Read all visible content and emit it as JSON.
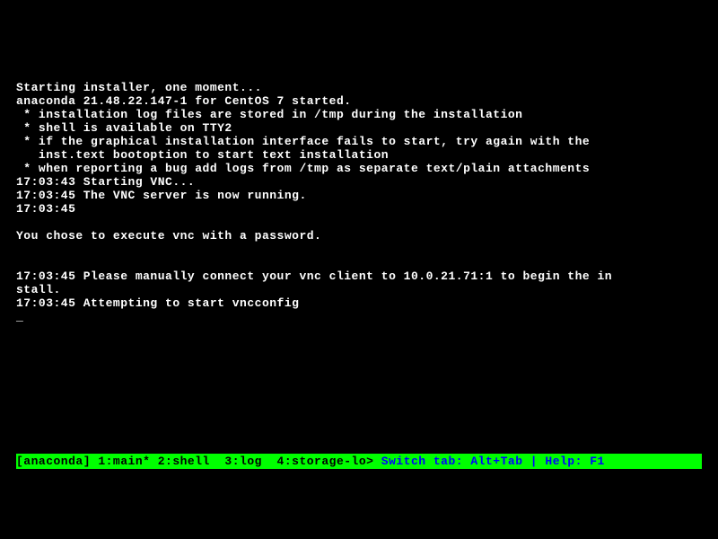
{
  "terminal": {
    "lines": [
      "Starting installer, one moment...",
      "anaconda 21.48.22.147-1 for CentOS 7 started.",
      " * installation log files are stored in /tmp during the installation",
      " * shell is available on TTY2",
      " * if the graphical installation interface fails to start, try again with the",
      "   inst.text bootoption to start text installation",
      " * when reporting a bug add logs from /tmp as separate text/plain attachments",
      "17:03:43 Starting VNC...",
      "17:03:45 The VNC server is now running.",
      "17:03:45 ",
      "",
      "You chose to execute vnc with a password. ",
      "",
      "",
      "17:03:45 Please manually connect your vnc client to 10.0.21.71:1 to begin the in",
      "stall.",
      "17:03:45 Attempting to start vncconfig"
    ],
    "cursor": "_"
  },
  "statusbar": {
    "left": "[anaconda] 1:main* 2:shell  3:log  4:storage-lo> ",
    "right": "Switch tab: Alt+Tab | Help: F1 "
  }
}
